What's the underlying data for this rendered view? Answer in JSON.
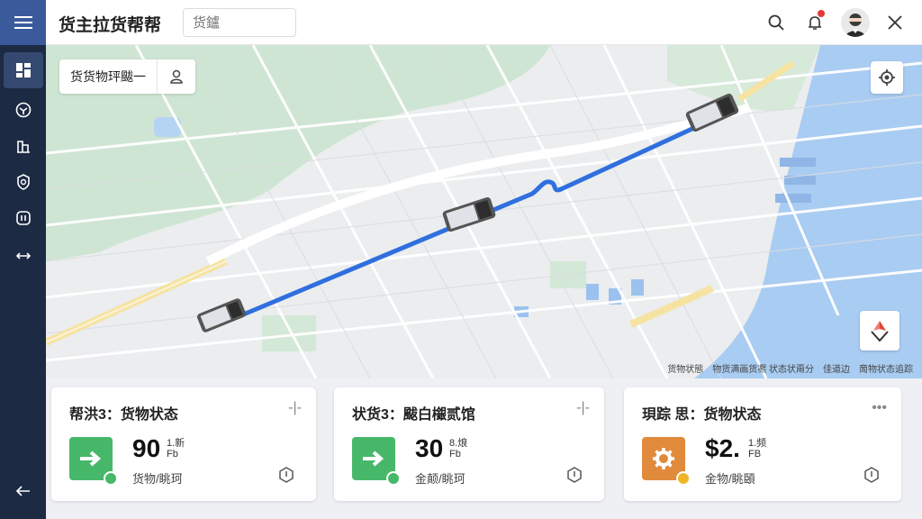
{
  "header": {
    "title": "货主拉货帮帮",
    "search_placeholder": "货鑪"
  },
  "sidebar": {
    "items": [
      {
        "icon": "dashboard-icon",
        "active": true
      },
      {
        "icon": "package-icon",
        "active": false
      },
      {
        "icon": "building-icon",
        "active": false
      },
      {
        "icon": "badge-icon",
        "active": false
      },
      {
        "icon": "bookmark-icon",
        "active": false
      },
      {
        "icon": "swap-icon",
        "active": false
      }
    ]
  },
  "map": {
    "vehicle_chip_label": "货货物玶颰一",
    "attribution": "货物状態　物货满画货凞 状态状甭分　佳道边　啇物状态追踪",
    "colors": {
      "route": "#2f6fde",
      "water": "#a9ccf2",
      "park": "#cfe5d3",
      "road_major": "#f6e3a2"
    }
  },
  "cards": [
    {
      "title": "帮洪3：货物状态",
      "value": "90",
      "value_sup": "1.新",
      "value_sub": "Fb",
      "caption": "货物/眺珂",
      "icon": "arrow-right-icon",
      "icon_color": "#47b86a",
      "menu": "-|-"
    },
    {
      "title": "状货3：颰白檭贰馆",
      "value": "30",
      "value_sup": "8.烺",
      "value_sub": "Fb",
      "caption": "金颠/眺珂",
      "icon": "arrow-right-icon",
      "icon_color": "#47b86a",
      "menu": "-|-"
    },
    {
      "title": "珼踪 思：货物状态",
      "value": "$2.",
      "value_sup": "1.频",
      "value_sub": "FB",
      "caption": "金物/眺頣",
      "icon": "gear-icon",
      "icon_color": "#e08a3c",
      "menu": "•••"
    }
  ]
}
